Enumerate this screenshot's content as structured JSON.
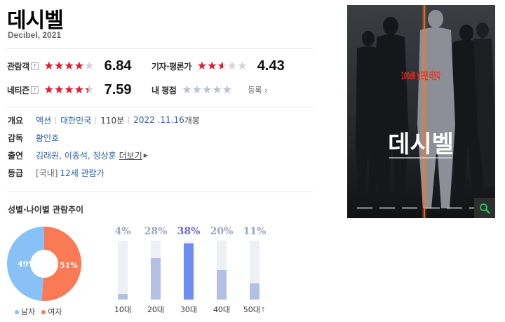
{
  "title": "데시벨",
  "subtitle": "Decibel, 2021",
  "ratings": {
    "audience": {
      "label": "관람객",
      "help": "?",
      "score": "6.84",
      "value": 6.84
    },
    "critic": {
      "label": "기자·평론가",
      "score": "4.43",
      "value": 4.43
    },
    "netizen": {
      "label": "네티즌",
      "help": "?",
      "score": "7.59",
      "value": 7.59
    },
    "mine": {
      "label": "내 평점",
      "register": "등록"
    }
  },
  "info": {
    "overview_label": "개요",
    "genre": "액션",
    "country": "대한민국",
    "runtime": "110분",
    "release_date": "2022 .11.16",
    "release_suffix": "개봉",
    "director_label": "감독",
    "director": "황인호",
    "cast_label": "출연",
    "cast": "김래원, 이종석, 정상훈",
    "more": "더보기",
    "grade_label": "등급",
    "grade_region": "[국내]",
    "grade": "12세 관람가"
  },
  "trend": {
    "section_title": "성별·나이별 관람추이",
    "gender": [
      {
        "label": "남자",
        "pct": "49%",
        "value": 49,
        "color": "#88c1f6"
      },
      {
        "label": "여자",
        "pct": "51%",
        "value": 51,
        "color": "#fa7a55"
      }
    ],
    "ages": [
      {
        "label": "10대",
        "pct": "4%",
        "value": 4
      },
      {
        "label": "20대",
        "pct": "28%",
        "value": 28
      },
      {
        "label": "30대",
        "pct": "38%",
        "value": 38,
        "highlight": true
      },
      {
        "label": "40대",
        "pct": "20%",
        "value": 20
      },
      {
        "label": "50대",
        "suffix": "↑",
        "pct": "11%",
        "value": 11
      }
    ]
  },
  "poster": {
    "tagline": "100dB 넘으면 터진다",
    "title": "데시벨"
  }
}
